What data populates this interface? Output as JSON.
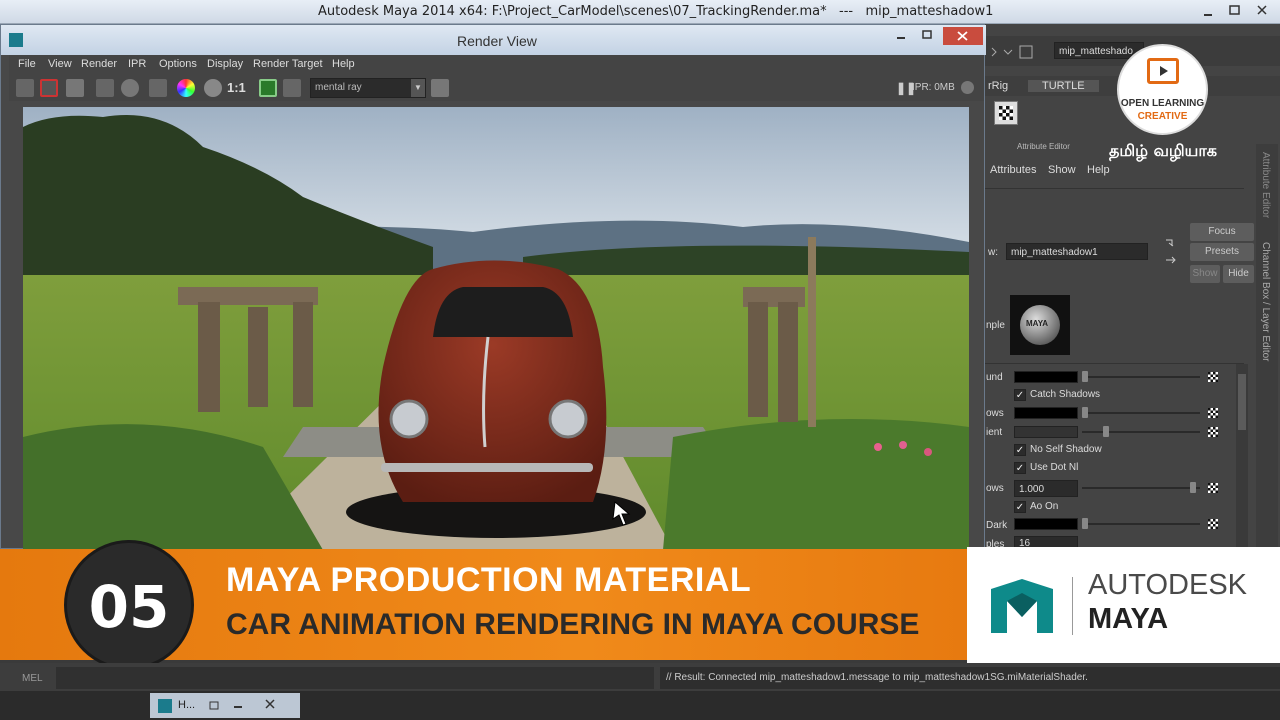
{
  "app": {
    "title": "Autodesk Maya 2014 x64: F:\\Project_CarModel\\scenes\\07_TrackingRender.ma*   ---   mip_matteshadow1"
  },
  "render_view": {
    "title": "Render View",
    "menu": [
      "File",
      "View",
      "Render",
      "IPR",
      "Options",
      "Display",
      "Render Target",
      "Help"
    ],
    "renderer": "mental ray",
    "ratio_label": "1:1",
    "ipr_status": "IPR: 0MB"
  },
  "right_panel": {
    "node_name": "mip_matteshado",
    "shelf_tabs": [
      "rRig",
      "TURTLE"
    ],
    "attribute_editor_label": "Attribute Editor",
    "menu": [
      "Attributes",
      "Show",
      "Help"
    ],
    "shader_label": "w:",
    "shader_value": "mip_matteshadow1",
    "buttons": {
      "focus": "Focus",
      "presets": "Presets",
      "show": "Show",
      "hide": "Hide"
    },
    "sample_label": "nple",
    "sample_swatch_text": "MAYA",
    "attrs": {
      "background": "und",
      "catch_shadows": "Catch Shadows",
      "shadows": "ows",
      "ambient": "ient",
      "no_self_shadow": "No Self Shadow",
      "use_dot_nl": "Use Dot Nl",
      "ao_rays_label": "ows",
      "ao_rays_value": "1.000",
      "ao_on": "Ao On",
      "ao_dark": "Dark",
      "ao_samples_label": "ples",
      "ao_samples_value": "16"
    },
    "side_tabs": [
      "Attribute Editor",
      "Channel Box / Layer Editor"
    ]
  },
  "branding": {
    "olc_line1": "OPEN LEARNING",
    "olc_line2": "CREATIVE",
    "tamil": "தமிழ் வழியாக"
  },
  "banner": {
    "lesson_number": "05",
    "title": "MAYA PRODUCTION MATERIAL",
    "subtitle": "CAR ANIMATION RENDERING IN MAYA COURSE",
    "logo_autodesk": "AUTODESK",
    "logo_maya": "MAYA"
  },
  "bottom": {
    "mel_label": "MEL",
    "result": "// Result: Connected mip_matteshadow1.message to mip_matteshadow1SG.miMaterialShader.",
    "task_label": "H..."
  },
  "colors": {
    "accent_orange": "#f08a1a",
    "maya_teal": "#0e8a8a"
  }
}
